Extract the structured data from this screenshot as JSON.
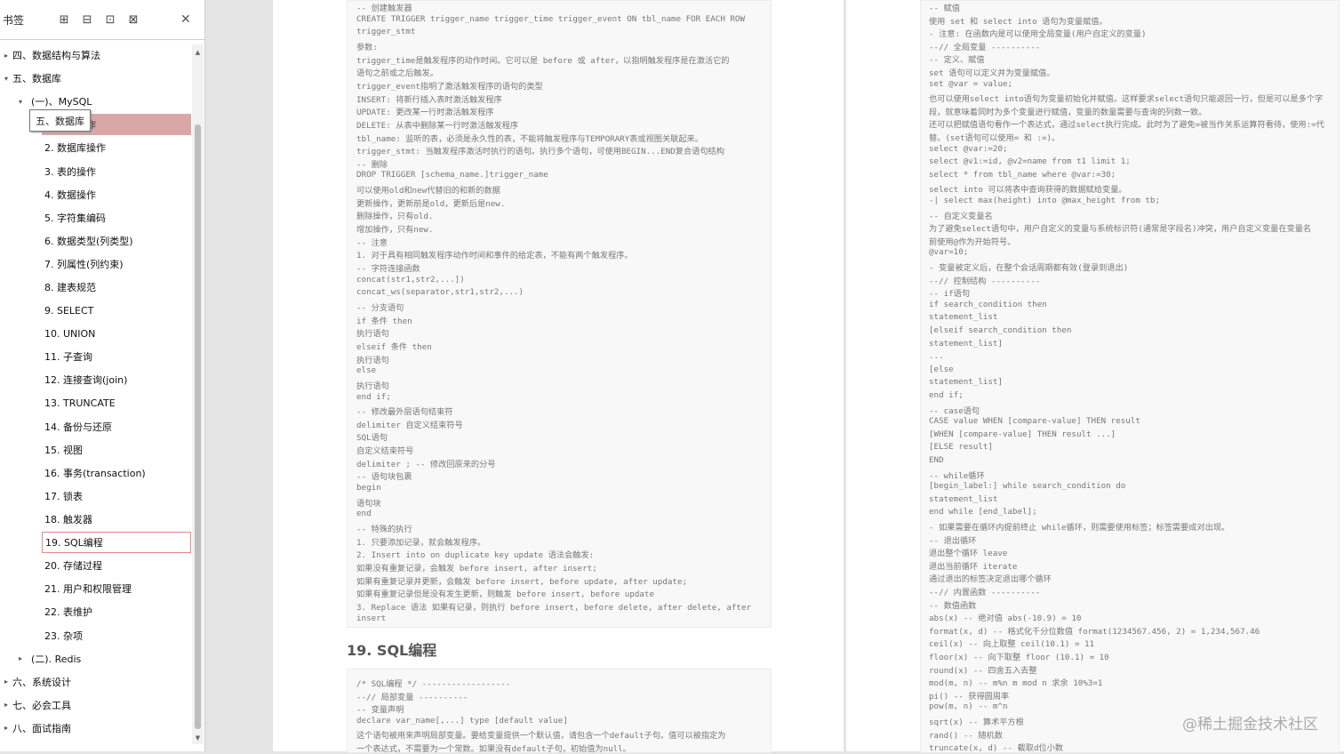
{
  "sidebar": {
    "title": "书签",
    "tools": [
      "⊞",
      "⊟",
      "⊡",
      "⊠"
    ],
    "close": "✕",
    "items": [
      {
        "label": "四、数据结构与算法",
        "level": 0,
        "chev": "▸"
      },
      {
        "label": "五、数据库",
        "level": 0,
        "chev": "▾"
      },
      {
        "label": "(一)、MySQL",
        "level": 1,
        "chev": "▾"
      },
      {
        "label": "1. 基本操作",
        "level": 2,
        "chev": ""
      },
      {
        "label": "2. 数据库操作",
        "level": 2,
        "chev": ""
      },
      {
        "label": "3. 表的操作",
        "level": 2,
        "chev": ""
      },
      {
        "label": "4. 数据操作",
        "level": 2,
        "chev": ""
      },
      {
        "label": "5. 字符集编码",
        "level": 2,
        "chev": ""
      },
      {
        "label": "6. 数据类型(列类型)",
        "level": 2,
        "chev": ""
      },
      {
        "label": "7. 列属性(列约束)",
        "level": 2,
        "chev": ""
      },
      {
        "label": "8. 建表规范",
        "level": 2,
        "chev": ""
      },
      {
        "label": "9. SELECT",
        "level": 2,
        "chev": ""
      },
      {
        "label": "10. UNION",
        "level": 2,
        "chev": ""
      },
      {
        "label": "11. 子查询",
        "level": 2,
        "chev": ""
      },
      {
        "label": "12. 连接查询(join)",
        "level": 2,
        "chev": ""
      },
      {
        "label": "13. TRUNCATE",
        "level": 2,
        "chev": ""
      },
      {
        "label": "14. 备份与还原",
        "level": 2,
        "chev": ""
      },
      {
        "label": "15. 视图",
        "level": 2,
        "chev": ""
      },
      {
        "label": "16. 事务(transaction)",
        "level": 2,
        "chev": ""
      },
      {
        "label": "17. 锁表",
        "level": 2,
        "chev": ""
      },
      {
        "label": "18. 触发器",
        "level": 2,
        "chev": ""
      },
      {
        "label": "19. SQL编程",
        "level": 2,
        "chev": ""
      },
      {
        "label": "20. 存储过程",
        "level": 2,
        "chev": ""
      },
      {
        "label": "21. 用户和权限管理",
        "level": 2,
        "chev": ""
      },
      {
        "label": "22. 表维护",
        "level": 2,
        "chev": ""
      },
      {
        "label": "23. 杂项",
        "level": 2,
        "chev": ""
      },
      {
        "label": "(二). Redis",
        "level": 1,
        "chev": "▸"
      },
      {
        "label": "六、系统设计",
        "level": 0,
        "chev": "▸"
      },
      {
        "label": "七、必会工具",
        "level": 0,
        "chev": "▸"
      },
      {
        "label": "八、面试指南",
        "level": 0,
        "chev": "▸"
      }
    ],
    "tooltip": "五、数据库"
  },
  "left_code": [
    "-- 创建触发器",
    "CREATE TRIGGER trigger_name trigger_time trigger_event ON tbl_name FOR EACH ROW",
    "trigger_stmt",
    "    参数:",
    "    trigger_time是触发程序的动作时间。它可以是 before 或 after，以指明触发程序是在激活它的",
    "语句之前或之后触发。",
    "    trigger_event指明了激活触发程序的语句的类型",
    "        INSERT: 将新行插入表时激活触发程序",
    "        UPDATE: 更改某一行时激活触发程序",
    "        DELETE: 从表中删除某一行时激活触发程序",
    "    tbl_name: 监听的表，必须是永久性的表，不能将触发程序与TEMPORARY表或视图关联起来。",
    "    trigger_stmt: 当触发程序激活时执行的语句。执行多个语句，可使用BEGIN...END复合语句结构",
    "-- 删除",
    "DROP TRIGGER [schema_name.]trigger_name",
    "可以使用old和new代替旧的和新的数据",
    "    更新操作，更新前是old，更新后是new.",
    "    删除操作，只有old.",
    "    增加操作，只有new.",
    "-- 注意",
    "    1. 对于具有相同触发程序动作时间和事件的给定表，不能有两个触发程序。",
    "-- 字符连接函数",
    "concat(str1,str2,...])",
    "concat_ws(separator,str1,str2,...)",
    "-- 分支语句",
    "if 条件 then",
    "    执行语句",
    "elseif 条件 then",
    "    执行语句",
    "else",
    "    执行语句",
    "end if;",
    "-- 修改最外层语句结束符",
    "delimiter 自定义结束符号",
    "    SQL语句",
    "自定义结束符号",
    "delimiter ;      -- 修改回原来的分号",
    "-- 语句块包裹",
    "begin",
    "    语句块",
    "end",
    "-- 特殊的执行",
    "1. 只要添加记录，就会触发程序。",
    "2. Insert into on duplicate key update 语法会触发:",
    "    如果没有重复记录，会触发 before insert, after insert;",
    "    如果有重复记录并更新，会触发 before insert, before update, after update;",
    "    如果有重复记录但是没有发生更新，则触发 before insert, before update",
    "3. Replace 语法 如果有记录，则执行 before insert, before delete, after delete, after",
    "insert"
  ],
  "section_title": "19. SQL编程",
  "left_code2": [
    "/* SQL编程 */ ------------------",
    "--// 局部变量 ----------",
    "-- 变量声明",
    "    declare var_name[,...] type [default value]",
    "    这个语句被用来声明局部变量。要给变量提供一个默认值，请包含一个default子句。值可以被指定为",
    "一个表达式，不需要为一个常数。如果没有default子句，初始值为null。"
  ],
  "right_code": [
    "-- 赋值",
    "    使用 set 和 select into 语句为变量赋值。",
    "    - 注意: 在函数内是可以使用全局变量(用户自定义的变量)",
    "--// 全局变量 ----------",
    "-- 定义、赋值",
    "set 语句可以定义并为变量赋值。",
    "set @var = value;",
    "也可以使用select into语句为变量初始化并赋值。这样要求select语句只能返回一行，但是可以是多个字",
    "段，就意味着同时为多个变量进行赋值，变量的数量需要与查询的列数一致。",
    "还可以把赋值语句看作一个表达式，通过select执行完成。此时为了避免=被当作关系运算符看待，使用:=代",
    "替。(set语句可以使用= 和 :=)。",
    "select @var:=20;",
    "select @v1:=id, @v2=name from t1 limit 1;",
    "select * from tbl_name where @var:=30;",
    "select into 可以将表中查询获得的数据赋给变量。",
    "    -| select max(height) into @max_height from tb;",
    "-- 自定义变量名",
    "为了避免select语句中，用户自定义的变量与系统标识符(通常是字段名)冲突，用户自定义变量在变量名",
    "前使用@作为开始符号。",
    "@var=10;",
    "    - 变量被定义后，在整个会话周期都有效(登录到退出)",
    "--// 控制结构 ----------",
    "-- if语句",
    "if search_condition then",
    "    statement_list",
    "[elseif search_condition then",
    "    statement_list]",
    "...",
    "[else",
    "    statement_list]",
    "end if;",
    "-- case语句",
    "CASE value WHEN [compare-value] THEN result",
    "[WHEN [compare-value] THEN result ...]",
    "[ELSE result]",
    "END",
    "-- while循环",
    "[begin_label:] while search_condition do",
    "    statement_list",
    "end while [end_label];",
    "- 如果需要在循环内提前终止 while循环，则需要使用标签；标签需要成对出现。",
    "    -- 退出循环",
    "        退出整个循环 leave",
    "        退出当前循环 iterate",
    "        通过退出的标签决定退出哪个循环",
    "--// 内置函数 ----------",
    "-- 数值函数",
    "abs(x)          -- 绝对值 abs(-10.9) = 10",
    "format(x, d)    -- 格式化千分位数值 format(1234567.456, 2) = 1,234,567.46",
    "ceil(x)         -- 向上取整 ceil(10.1) = 11",
    "floor(x)        -- 向下取整 floor (10.1) = 10",
    "round(x)        -- 四舍五入去整",
    "mod(m, n)       -- m%n m mod n 求余 10%3=1",
    "pi()            -- 获得圆周率",
    "pow(m, n)       -- m^n",
    "sqrt(x)         -- 算术平方根",
    "rand()          -- 随机数",
    "truncate(x, d)  -- 截取d位小数"
  ],
  "watermark": "@稀土掘金技术社区"
}
